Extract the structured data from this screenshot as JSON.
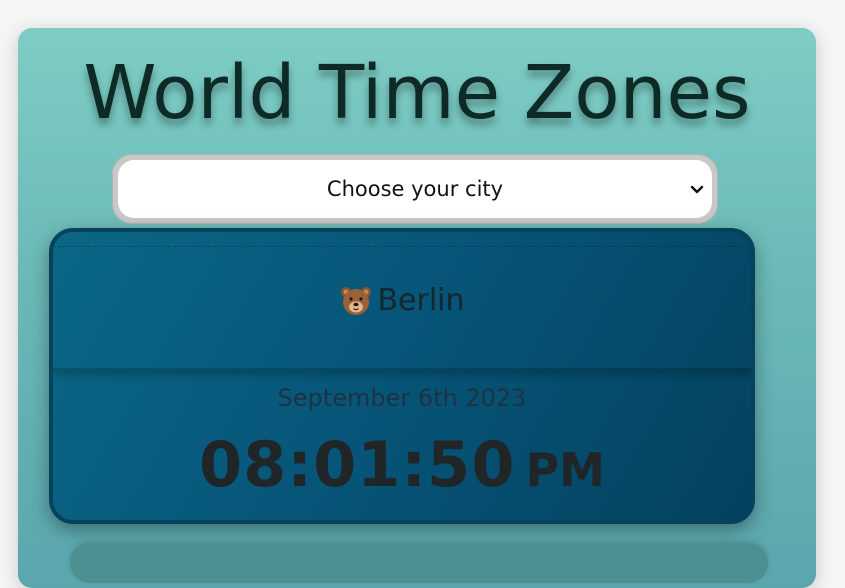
{
  "header": {
    "title": "World Time Zones"
  },
  "city_select": {
    "selected_label": "Choose your city",
    "icon": "chevron-down-icon"
  },
  "clock_card": {
    "city_icon": "bear-icon",
    "city": "Berlin",
    "date": "September 6th 2023",
    "time": "08:01:50",
    "ampm": "PM"
  },
  "colors": {
    "panel_teal": "#7ecdc4",
    "card_blue": "#07567a",
    "title_dark": "#0d2a27"
  }
}
